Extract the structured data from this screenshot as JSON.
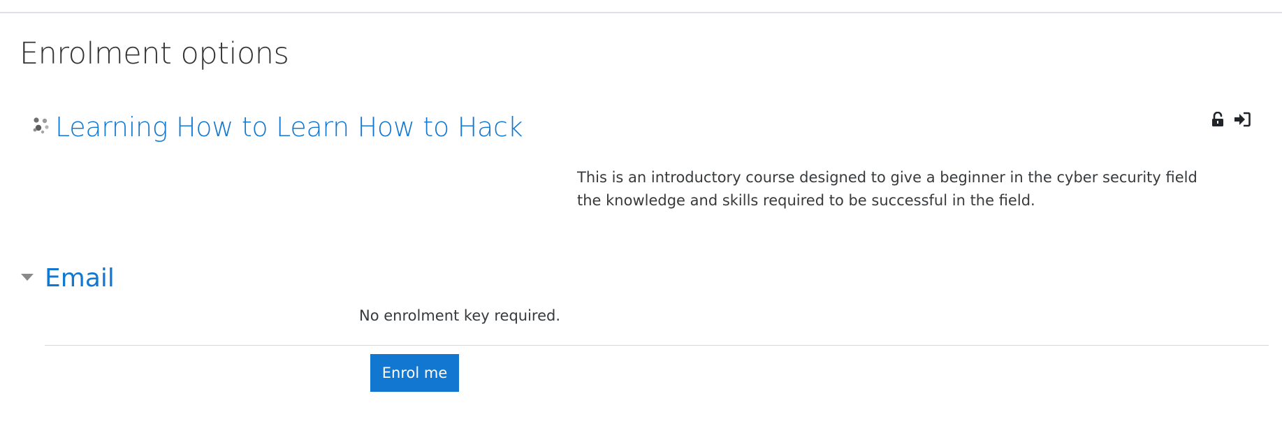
{
  "page": {
    "title": "Enrolment options"
  },
  "course": {
    "icon": "course-topic-icon",
    "name": "Learning How to Learn How to Hack",
    "summary": "This is an introductory course designed to give a beginner in the cyber security field the knowledge and skills required to be successful in the field.",
    "enrol_icons": [
      "unlock-icon",
      "sign-in-icon"
    ]
  },
  "enrol_section": {
    "toggle_icon": "caret-down-icon",
    "title": "Email",
    "key_status": "No enrolment key required.",
    "submit_label": "Enrol me"
  },
  "colors": {
    "link": "#1177d1",
    "button_bg": "#1177d1",
    "button_text": "#ffffff",
    "text": "#373a3c",
    "rule": "#dee2e6"
  }
}
